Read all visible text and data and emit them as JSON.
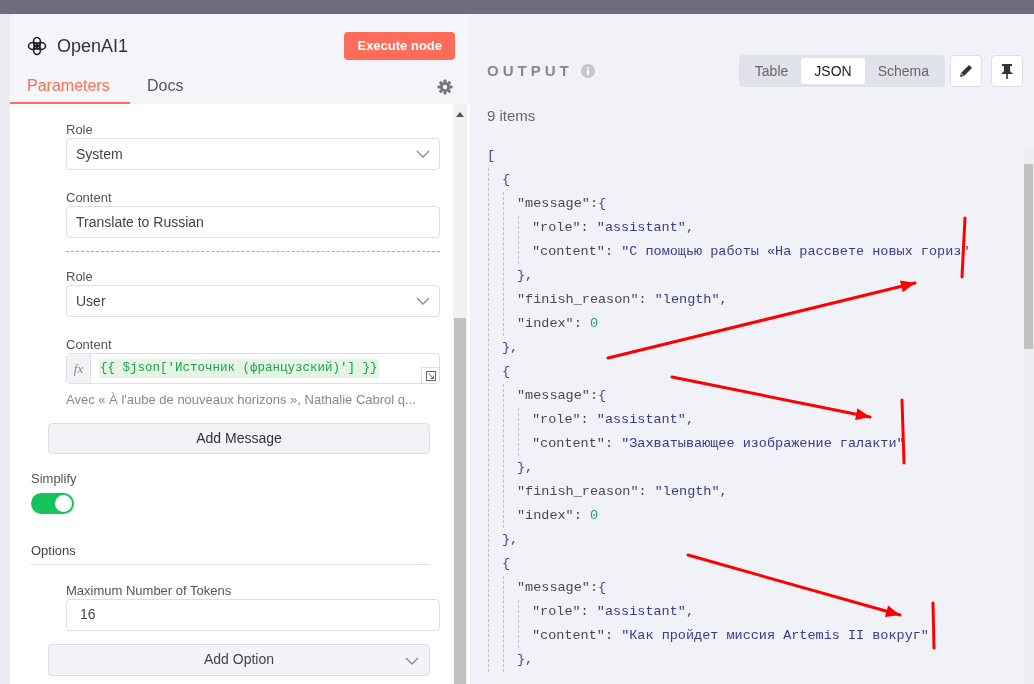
{
  "node": {
    "title": "OpenAI1",
    "execute_label": "Execute node",
    "tabs": [
      {
        "label": "Parameters",
        "selected": true
      },
      {
        "label": "Docs",
        "selected": false
      }
    ]
  },
  "messages": [
    {
      "kind": "text",
      "role_label": "Role",
      "role": "System",
      "content_label": "Content",
      "content": "Translate to Russian"
    },
    {
      "kind": "expression",
      "role_label": "Role",
      "role": "User",
      "content_label": "Content",
      "fx": "fx",
      "content": "{{ $json['Источник (французский)'] }}",
      "hint": "Avec « À l'aube de nouveaux horizons », Nathalie Cabrol q..."
    }
  ],
  "add_message": "Add Message",
  "simplify": {
    "label": "Simplify",
    "on": true
  },
  "options": {
    "title": "Options",
    "fields": [
      {
        "label": "Maximum Number of Tokens",
        "value": "16"
      }
    ],
    "add_label": "Add Option"
  },
  "output": {
    "title": "OUTPUT",
    "views": [
      {
        "label": "Table",
        "selected": false
      },
      {
        "label": "JSON",
        "selected": true
      },
      {
        "label": "Schema",
        "selected": false
      }
    ],
    "count": "9 items",
    "json": {
      "line": [
        {
          "kind": "bracket",
          "text": "["
        }
      ],
      "children": [
        {
          "line": [
            {
              "kind": "bracket",
              "text": "{"
            }
          ],
          "children": [
            {
              "line": [
                {
                  "kind": "key",
                  "text": "\"message\""
                },
                {
                  "kind": "punct",
                  "text": ":"
                },
                {
                  "kind": "bracket",
                  "text": "{"
                }
              ],
              "children": [
                {
                  "line": [
                    {
                      "kind": "key",
                      "text": "\"role\""
                    },
                    {
                      "kind": "punct",
                      "text": ": "
                    },
                    {
                      "kind": "string",
                      "text": "\"assistant\""
                    },
                    {
                      "kind": "punct",
                      "text": ","
                    }
                  ]
                },
                {
                  "line": [
                    {
                      "kind": "key",
                      "text": "\"content\""
                    },
                    {
                      "kind": "punct",
                      "text": ": "
                    },
                    {
                      "kind": "string",
                      "text": "\"С помощью работы «На рассвете новых гориз\""
                    }
                  ]
                }
              ],
              "close": [
                {
                  "kind": "bracket",
                  "text": "}"
                },
                {
                  "kind": "punct",
                  "text": ","
                }
              ]
            },
            {
              "line": [
                {
                  "kind": "key",
                  "text": "\"finish_reason\""
                },
                {
                  "kind": "punct",
                  "text": ": "
                },
                {
                  "kind": "string",
                  "text": "\"length\""
                },
                {
                  "kind": "punct",
                  "text": ","
                }
              ]
            },
            {
              "line": [
                {
                  "kind": "key",
                  "text": "\"index\""
                },
                {
                  "kind": "punct",
                  "text": ": "
                },
                {
                  "kind": "number",
                  "text": "0"
                }
              ]
            }
          ],
          "close": [
            {
              "kind": "bracket",
              "text": "}"
            },
            {
              "kind": "punct",
              "text": ","
            }
          ]
        },
        {
          "line": [
            {
              "kind": "bracket",
              "text": "{"
            }
          ],
          "children": [
            {
              "line": [
                {
                  "kind": "key",
                  "text": "\"message\""
                },
                {
                  "kind": "punct",
                  "text": ":"
                },
                {
                  "kind": "bracket",
                  "text": "{"
                }
              ],
              "children": [
                {
                  "line": [
                    {
                      "kind": "key",
                      "text": "\"role\""
                    },
                    {
                      "kind": "punct",
                      "text": ": "
                    },
                    {
                      "kind": "string",
                      "text": "\"assistant\""
                    },
                    {
                      "kind": "punct",
                      "text": ","
                    }
                  ]
                },
                {
                  "line": [
                    {
                      "kind": "key",
                      "text": "\"content\""
                    },
                    {
                      "kind": "punct",
                      "text": ": "
                    },
                    {
                      "kind": "string",
                      "text": "\"Захватывающее изображение галакти\""
                    }
                  ]
                }
              ],
              "close": [
                {
                  "kind": "bracket",
                  "text": "}"
                },
                {
                  "kind": "punct",
                  "text": ","
                }
              ]
            },
            {
              "line": [
                {
                  "kind": "key",
                  "text": "\"finish_reason\""
                },
                {
                  "kind": "punct",
                  "text": ": "
                },
                {
                  "kind": "string",
                  "text": "\"length\""
                },
                {
                  "kind": "punct",
                  "text": ","
                }
              ]
            },
            {
              "line": [
                {
                  "kind": "key",
                  "text": "\"index\""
                },
                {
                  "kind": "punct",
                  "text": ": "
                },
                {
                  "kind": "number",
                  "text": "0"
                }
              ]
            }
          ],
          "close": [
            {
              "kind": "bracket",
              "text": "}"
            },
            {
              "kind": "punct",
              "text": ","
            }
          ]
        },
        {
          "line": [
            {
              "kind": "bracket",
              "text": "{"
            }
          ],
          "children": [
            {
              "line": [
                {
                  "kind": "key",
                  "text": "\"message\""
                },
                {
                  "kind": "punct",
                  "text": ":"
                },
                {
                  "kind": "bracket",
                  "text": "{"
                }
              ],
              "children": [
                {
                  "line": [
                    {
                      "kind": "key",
                      "text": "\"role\""
                    },
                    {
                      "kind": "punct",
                      "text": ": "
                    },
                    {
                      "kind": "string",
                      "text": "\"assistant\""
                    },
                    {
                      "kind": "punct",
                      "text": ","
                    }
                  ]
                },
                {
                  "line": [
                    {
                      "kind": "key",
                      "text": "\"content\""
                    },
                    {
                      "kind": "punct",
                      "text": ": "
                    },
                    {
                      "kind": "string",
                      "text": "\"Как пройдет миссия Artemis II вокруг\""
                    }
                  ]
                }
              ],
              "close": [
                {
                  "kind": "bracket",
                  "text": "}"
                },
                {
                  "kind": "punct",
                  "text": ","
                }
              ]
            }
          ]
        }
      ]
    }
  }
}
